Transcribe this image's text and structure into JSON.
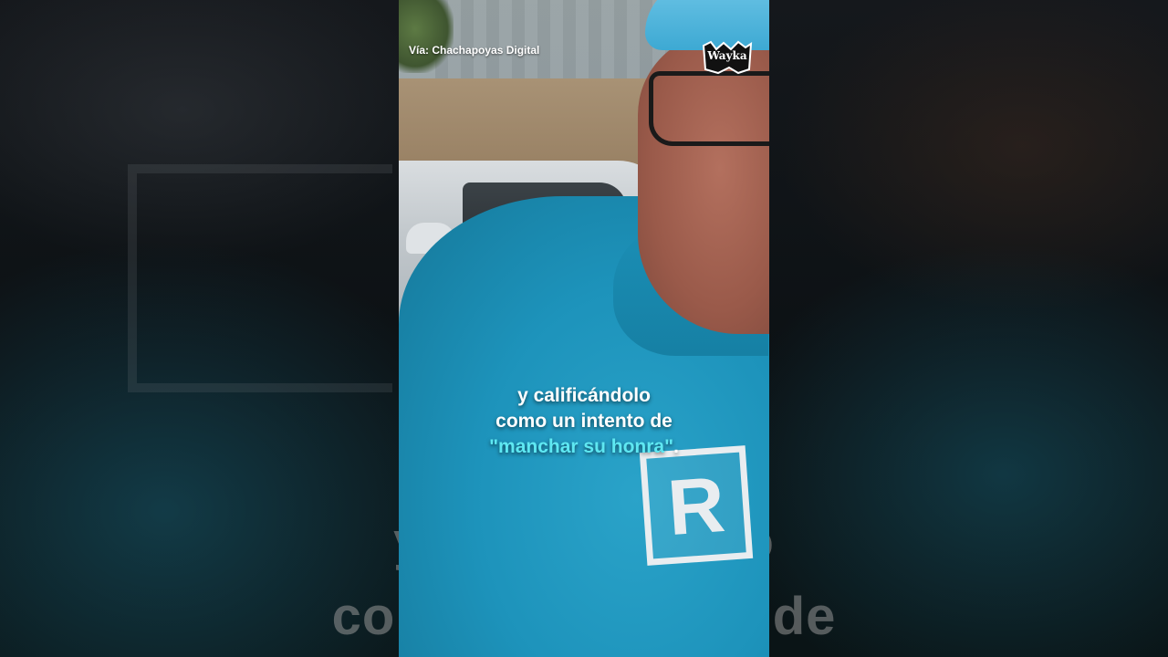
{
  "video": {
    "source": "Vía: Chachapoyas Digital",
    "brand": "Wayka",
    "shirt_logo_letter": "R"
  },
  "caption": {
    "line1": "y calificándolo",
    "line2": "como un intento de",
    "line3_highlight": "\"manchar su honra\"",
    "line3_end": ".",
    "highlight_color": "#5ee8f2"
  },
  "background": {
    "blur_line1": "y calificándolo",
    "blur_line2": "como un intento de"
  }
}
